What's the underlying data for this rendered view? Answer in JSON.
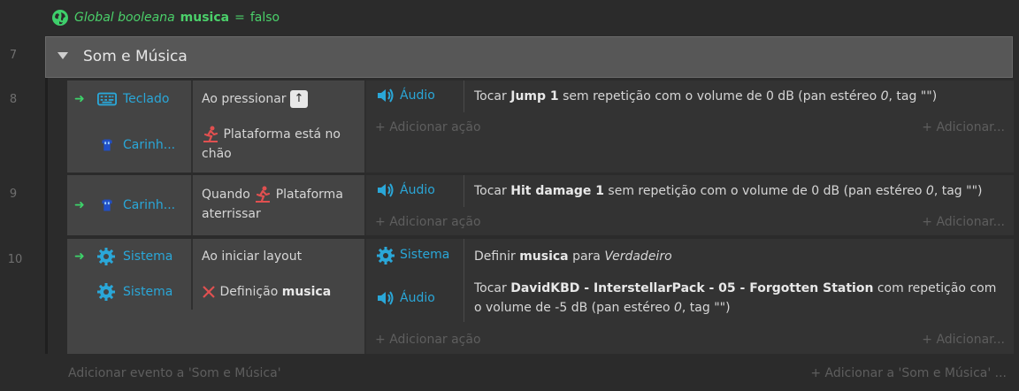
{
  "global_var": {
    "prefix": "Global booleana",
    "name": "musica",
    "equals": "=",
    "value": "falso"
  },
  "line_numbers": [
    "7",
    "8",
    "9",
    "10"
  ],
  "group": {
    "title": "Som e Música"
  },
  "events": [
    {
      "conditions": [
        {
          "object": "Teclado",
          "icon": "keyboard-icon",
          "text_pre": "Ao pressionar",
          "key": "↑"
        },
        {
          "object": "Carinh...",
          "icon": "character-sprite-icon",
          "text": "Plataforma está no chão"
        }
      ],
      "actions": [
        {
          "object": "Áudio",
          "text_pre": "Tocar",
          "bold": "Jump 1",
          "text_post": "sem repetição com o volume de 0 dB (pan estéreo",
          "ital": "0",
          "text_end": ", tag \"\")"
        }
      ],
      "add_action": "Adicionar ação",
      "add_more": "Adicionar..."
    },
    {
      "conditions": [
        {
          "object": "Carinh...",
          "icon": "character-sprite-icon",
          "text_pre": "Quando",
          "text_post": "Plataforma aterrissar"
        }
      ],
      "actions": [
        {
          "object": "Áudio",
          "text_pre": "Tocar",
          "bold": "Hit damage 1",
          "text_post": "sem repetição com o volume de 0 dB (pan estéreo",
          "ital": "0",
          "text_end": ", tag \"\")"
        }
      ],
      "add_action": "Adicionar ação",
      "add_more": "Adicionar..."
    },
    {
      "conditions": [
        {
          "object": "Sistema",
          "icon": "gear-icon",
          "text": "Ao iniciar layout"
        },
        {
          "object": "Sistema",
          "icon": "gear-icon",
          "text_pre": "Definição",
          "bold": "musica"
        }
      ],
      "actions": [
        {
          "object": "Sistema",
          "text_pre": "Definir",
          "bold": "musica",
          "text_post": "para",
          "ital": "Verdadeiro"
        },
        {
          "object": "Áudio",
          "text_pre": "Tocar",
          "bold": "DavidKBD - InterstellarPack - 05 - Forgotten Station",
          "text_post": "com repetição com o volume de -5 dB (pan estéreo",
          "ital": "0",
          "text_end": ", tag \"\")"
        }
      ],
      "add_action": "Adicionar ação",
      "add_more": "Adicionar..."
    }
  ],
  "footer": {
    "add_event": "Adicionar evento a 'Som e Música'",
    "add_to": "Adicionar a 'Som e Música' ..."
  },
  "colors": {
    "object_name": "#2aa7d8",
    "arrow": "#3dd36a",
    "global_text": "#4bd06a",
    "invert_x": "#e05050",
    "behavior_icon": "#e05050"
  }
}
